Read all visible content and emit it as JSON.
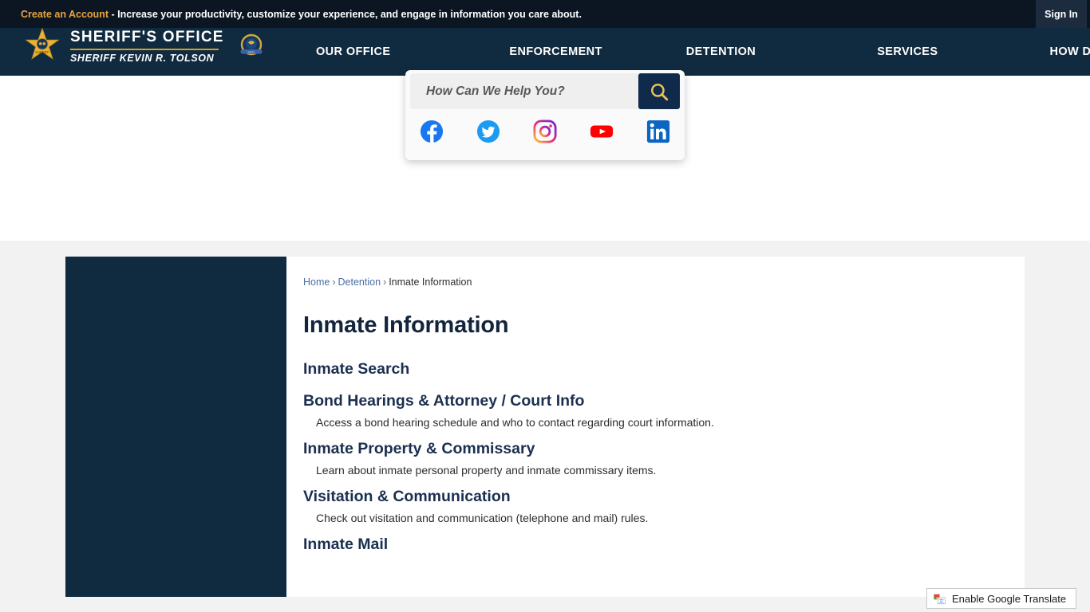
{
  "account_bar": {
    "link_label": "Create an Account",
    "message": " - Increase your productivity, customize your experience, and engage in information you care about.",
    "sign_in_label": "Sign In"
  },
  "brand": {
    "line1": "SHERIFF'S OFFICE",
    "line2": "SHERIFF KEVIN R.  TOLSON",
    "badge_icon": "sheriff-star-badge-icon",
    "seal_icon": "county-seal-icon"
  },
  "nav": {
    "items": [
      {
        "label": "OUR OFFICE"
      },
      {
        "label": "ENFORCEMENT"
      },
      {
        "label": "DETENTION"
      },
      {
        "label": "SERVICES"
      },
      {
        "label": "HOW DO I..."
      }
    ]
  },
  "search": {
    "placeholder": "How Can We Help You?",
    "value": "",
    "button_icon": "search-icon",
    "button_icon_color": "#e8c25c"
  },
  "social": {
    "items": [
      {
        "name": "facebook-icon",
        "color": "#1877f2"
      },
      {
        "name": "twitter-icon",
        "color": "#1d9bf0"
      },
      {
        "name": "instagram-icon",
        "color": "#e1306c"
      },
      {
        "name": "youtube-icon",
        "color": "#ff0000"
      },
      {
        "name": "linkedin-icon",
        "color": "#0a66c2"
      }
    ]
  },
  "breadcrumb": {
    "home": "Home",
    "sep1": "›",
    "section": "Detention",
    "sep2": "›",
    "current": "Inmate Information"
  },
  "main": {
    "title": "Inmate Information",
    "links": [
      {
        "title": "Inmate Search",
        "desc": ""
      },
      {
        "title": "Bond Hearings & Attorney / Court Info",
        "desc": "Access a bond hearing schedule and who to contact regarding court information."
      },
      {
        "title": "Inmate Property & Commissary",
        "desc": "Learn about inmate personal property and inmate commissary items."
      },
      {
        "title": "Visitation & Communication",
        "desc": "Check out visitation and communication (telephone and mail) rules."
      },
      {
        "title": "Inmate Mail",
        "desc": ""
      }
    ]
  },
  "translate_widget": {
    "label": "Enable Google Translate",
    "icon": "google-translate-icon"
  },
  "colors": {
    "navy": "#102a3f",
    "dark_bar": "#0b1622",
    "gold": "#d4a029",
    "gray_band": "#f2f2f2",
    "heading": "#1b3050"
  }
}
